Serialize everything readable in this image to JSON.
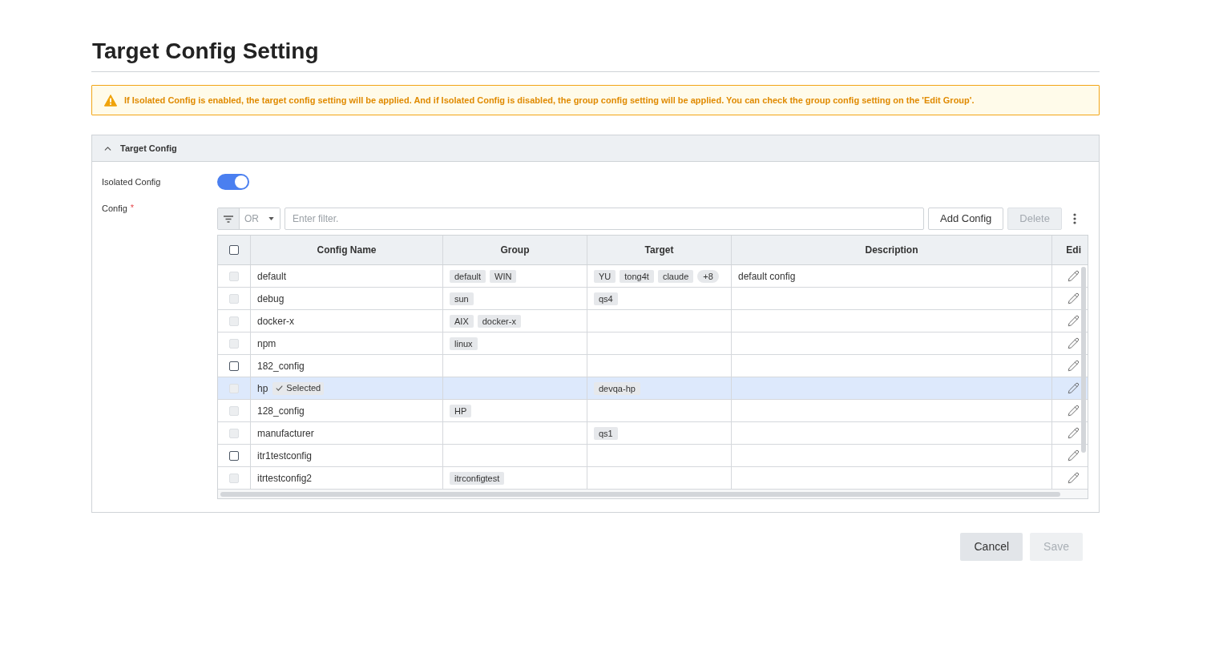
{
  "page": {
    "title": "Target Config Setting"
  },
  "alert": {
    "text": "If Isolated Config is enabled, the target config setting will be applied. And if Isolated Config is disabled, the group config setting will be applied. You can check the group config setting on the 'Edit Group'."
  },
  "section": {
    "title": "Target Config",
    "expanded": true
  },
  "isolated_config": {
    "label": "Isolated Config",
    "on": true
  },
  "config": {
    "label": "Config",
    "required_mark": "*"
  },
  "toolbar": {
    "operator": "OR",
    "filter_placeholder": "Enter filter.",
    "buttons": [
      {
        "label": "Add Config",
        "disabled": false
      },
      {
        "label": "Delete",
        "disabled": true
      }
    ]
  },
  "table": {
    "header_checkbox": {
      "checked": false,
      "disabled": false
    },
    "columns": [
      "Config Name",
      "Group",
      "Target",
      "Description",
      "Edi"
    ],
    "rows": [
      {
        "name": "default",
        "checkbox": {
          "checked": false,
          "disabled": true
        },
        "selected": false,
        "group": [
          "default",
          "WIN"
        ],
        "target": [
          "YU",
          "tong4t",
          "claude"
        ],
        "target_more": "+8",
        "description": "default config"
      },
      {
        "name": "debug",
        "checkbox": {
          "checked": false,
          "disabled": true
        },
        "selected": false,
        "group": [
          "sun"
        ],
        "target": [
          "qs4"
        ]
      },
      {
        "name": "docker-x",
        "checkbox": {
          "checked": false,
          "disabled": true
        },
        "selected": false,
        "group": [
          "AIX",
          "docker-x"
        ],
        "target": []
      },
      {
        "name": "npm",
        "checkbox": {
          "checked": false,
          "disabled": true
        },
        "selected": false,
        "group": [
          "linux"
        ],
        "target": []
      },
      {
        "name": "182_config",
        "checkbox": {
          "checked": false,
          "disabled": false
        },
        "selected": false,
        "group": [],
        "target": []
      },
      {
        "name": "hp",
        "badge": "Selected",
        "checkbox": {
          "checked": false,
          "disabled": true
        },
        "selected": true,
        "group": [],
        "target": [
          "devqa-hp"
        ]
      },
      {
        "name": "128_config",
        "checkbox": {
          "checked": false,
          "disabled": true
        },
        "selected": false,
        "group": [
          "HP"
        ],
        "target": []
      },
      {
        "name": "manufacturer",
        "checkbox": {
          "checked": false,
          "disabled": true
        },
        "selected": false,
        "group": [],
        "target": [
          "qs1"
        ]
      },
      {
        "name": "itr1testconfig",
        "checkbox": {
          "checked": false,
          "disabled": false
        },
        "selected": false,
        "group": [],
        "target": []
      },
      {
        "name": "itrtestconfig2",
        "checkbox": {
          "checked": false,
          "disabled": true
        },
        "selected": false,
        "group": [
          "itrconfigtest"
        ],
        "target": []
      }
    ]
  },
  "footer": {
    "buttons": [
      {
        "label": "Cancel",
        "disabled": false
      },
      {
        "label": "Save",
        "disabled": true
      }
    ]
  }
}
